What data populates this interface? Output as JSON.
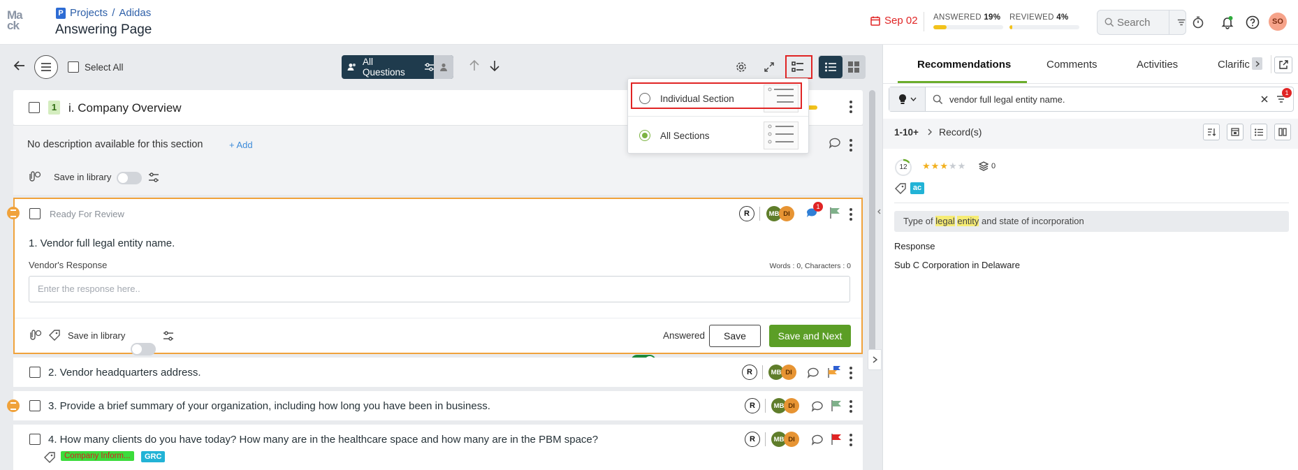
{
  "header": {
    "logo_text": "Ma ck",
    "breadcrumb_projects": "Projects",
    "breadcrumb_sep": "/",
    "breadcrumb_project": "Adidas",
    "page_title": "Answering Page",
    "due_date": "Sep 02",
    "answered_label": "ANSWERED",
    "answered_pct": "19%",
    "answered_value": 0.19,
    "reviewed_label": "REVIEWED",
    "reviewed_pct": "4%",
    "reviewed_value": 0.04,
    "search_placeholder": "Search",
    "avatar_initials": "SO"
  },
  "toolbar": {
    "select_all": "Select All",
    "filter_label": "All Questions"
  },
  "section": {
    "number": "1",
    "title": "i. Company Overview",
    "no_description": "No description available for this section",
    "add_label": "+ Add",
    "save_in_library": "Save in library"
  },
  "popover": {
    "option_individual": "Individual Section",
    "option_all": "All Sections",
    "selected": "All Sections"
  },
  "question1": {
    "status": "Ready For Review",
    "title": "1. Vendor full legal entity name.",
    "response_label": "Vendor's Response",
    "counts": "Words : 0, Characters : 0",
    "placeholder": "Enter the response here..",
    "save_in_library": "Save in library",
    "answered_label": "Answered",
    "save_button": "Save",
    "save_next_button": "Save and Next",
    "comment_badge": "1"
  },
  "assignees": {
    "a": "MB",
    "b": "DI"
  },
  "questions": [
    {
      "title": "2. Vendor headquarters address."
    },
    {
      "title": "3. Provide a brief summary of your organization, including how long you have been in business."
    },
    {
      "title": "4. How many clients do you have today? How many are in the healthcare space and how many are in the PBM space?"
    }
  ],
  "q4_tags": [
    "Company Inform...",
    "GRC"
  ],
  "right_panel": {
    "tabs": [
      "Recommendations",
      "Comments",
      "Activities",
      "Clarific"
    ],
    "search_value": "vendor full legal entity name.",
    "filter_badge": "1",
    "records_range": "1-10+",
    "records_label": "Record(s)",
    "score": "12",
    "rating": 3,
    "rating_max": 5,
    "layers_count": "0",
    "tag": "ac",
    "match_prefix": "Type of ",
    "match_hl1": "legal",
    "match_space": " ",
    "match_hl2": "entity",
    "match_suffix": " and state of incorporation",
    "response_heading": "Response",
    "response_text": "Sub C Corporation in Delaware"
  },
  "colors": {
    "accent_green": "#5b9e26",
    "highlight_orange": "#f0a23b",
    "dark_navy": "#1f3b4d",
    "alert_red": "#e02424"
  }
}
